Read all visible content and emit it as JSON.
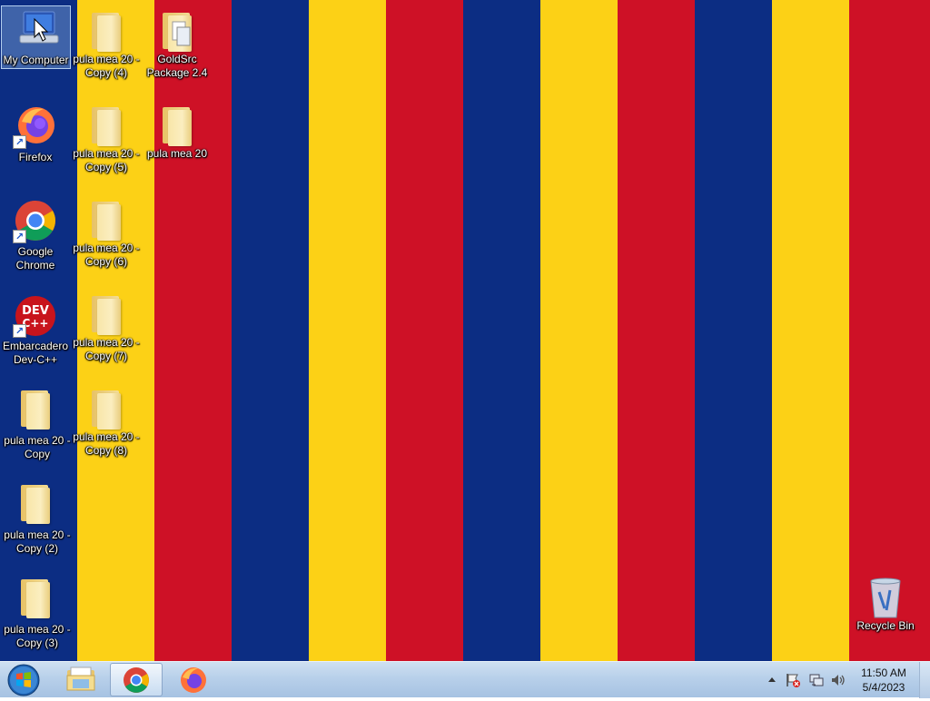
{
  "wallpaper": {
    "stripes": [
      "#0c2d83",
      "#fcd116",
      "#ce1126",
      "#0c2d83",
      "#fcd116",
      "#ce1126",
      "#0c2d83",
      "#fcd116",
      "#ce1126",
      "#0c2d83",
      "#fcd116",
      "#ce1126"
    ]
  },
  "desktop_icons": {
    "my_computer": "My Computer",
    "firefox": "Firefox",
    "chrome": "Google Chrome",
    "devcpp": "Embarcadero Dev-C++",
    "pula_copy": "pula mea 20 - Copy",
    "pula_copy2": "pula mea 20 - Copy (2)",
    "pula_copy3": "pula mea 20 - Copy (3)",
    "pula_copy4": "pula mea 20 - Copy (4)",
    "pula_copy5": "pula mea 20 - Copy (5)",
    "pula_copy6": "pula mea 20 - Copy (6)",
    "pula_copy7": "pula mea 20 - Copy (7)",
    "pula_copy8": "pula mea 20 - Copy (8)",
    "goldsrc": "GoldSrc Package 2.4",
    "pula": "pula mea 20",
    "recycle_bin": "Recycle Bin"
  },
  "taskbar": {
    "pinned": [
      "start-orb-icon",
      "file-explorer-icon",
      "chrome-icon",
      "firefox-icon"
    ],
    "active": "chrome-icon"
  },
  "tray": {
    "time": "11:50 AM",
    "date": "5/4/2023",
    "icons": [
      "show-hidden-icons-arrow",
      "action-center-flag-icon",
      "network-icon",
      "volume-icon"
    ]
  }
}
